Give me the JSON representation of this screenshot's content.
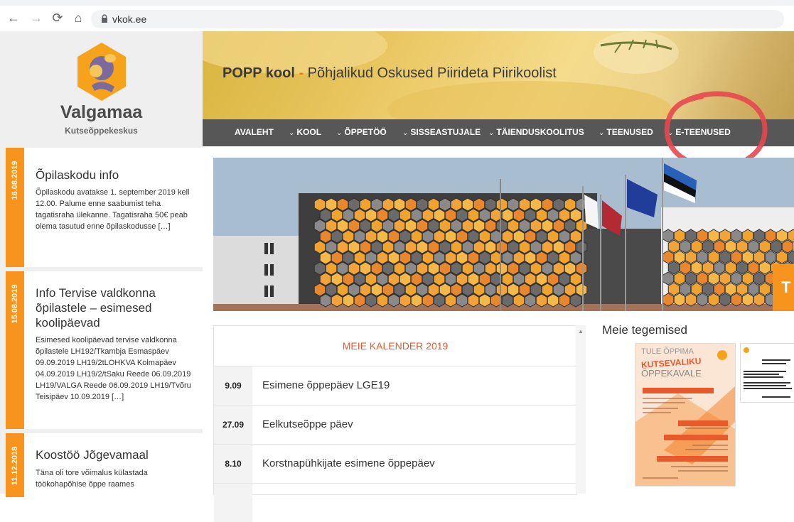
{
  "browser": {
    "url": "vkok.ee"
  },
  "logo": {
    "name": "Valgamaa",
    "subtitle": "Kutseõppekeskus"
  },
  "header": {
    "brand": "POPP kool",
    "separator": " - ",
    "tagline": "Põhjalikud Oskused Piirideta Piirikoolist"
  },
  "menu": [
    {
      "label": "AVALEHT",
      "chevron": false
    },
    {
      "label": "KOOL",
      "chevron": true
    },
    {
      "label": "ÕPPETÖÖ",
      "chevron": true
    },
    {
      "label": "SISSEASTUJALE",
      "chevron": true
    },
    {
      "label": "TÄIENDUSKOOLITUS",
      "chevron": true
    },
    {
      "label": "TEENUSED",
      "chevron": true
    },
    {
      "label": "E-TEENUSED",
      "chevron": true
    }
  ],
  "news": [
    {
      "date": "16.08.2019",
      "title": "Õpilaskodu info",
      "body": "Õpilaskodu avatakse 1. september 2019 kell 12.00.  Palume enne saabumist teha tagatisraha ülekanne. Tagatisraha 50€ peab olema tasutud enne õpilaskodusse […]"
    },
    {
      "date": "15.08.2019",
      "title": "Info Tervise valdkonna õpilastele – esimesed koolipäevad",
      "body": "Esimesed koolipäevad tervise valdkonna õpilastele LH192/Tkambja Esmaspäev 09.09.2019 LH19/2tLOHKVA Kolmapäev 04.09.2019 LH19/2/tSaku Reede 06.09.2019 LH19/VALGA Reede 06.09.2019 LH19/Tvõru Teisipäev 10.09.2019 […]"
    },
    {
      "date": "11.12.2018",
      "title": "Koostöö Jõgevamaal",
      "body": "Täna oli tore võimalus külastada töökohapõhise õppe raames"
    }
  ],
  "calendar": {
    "title": "MEIE KALENDER 2019",
    "events": [
      {
        "date": "9.09",
        "text": "Esimene õppepäev LGE19"
      },
      {
        "date": "27.09",
        "text": "Eelkutseõppe päev"
      },
      {
        "date": "8.10",
        "text": "Korstnapühkijate esimene õppepäev"
      }
    ]
  },
  "activities": {
    "title": "Meie tegemised",
    "poster": {
      "line1": "TULE ÕPPIMA",
      "line2": "KUTSEVALIKU",
      "line3": "ÕPPEKAVALE"
    }
  },
  "photo_caption": "T",
  "colors": {
    "accent": "#f7941d",
    "menu_bg": "#575757",
    "calendar_title": "#e8592b",
    "annotation": "#e8474e"
  }
}
